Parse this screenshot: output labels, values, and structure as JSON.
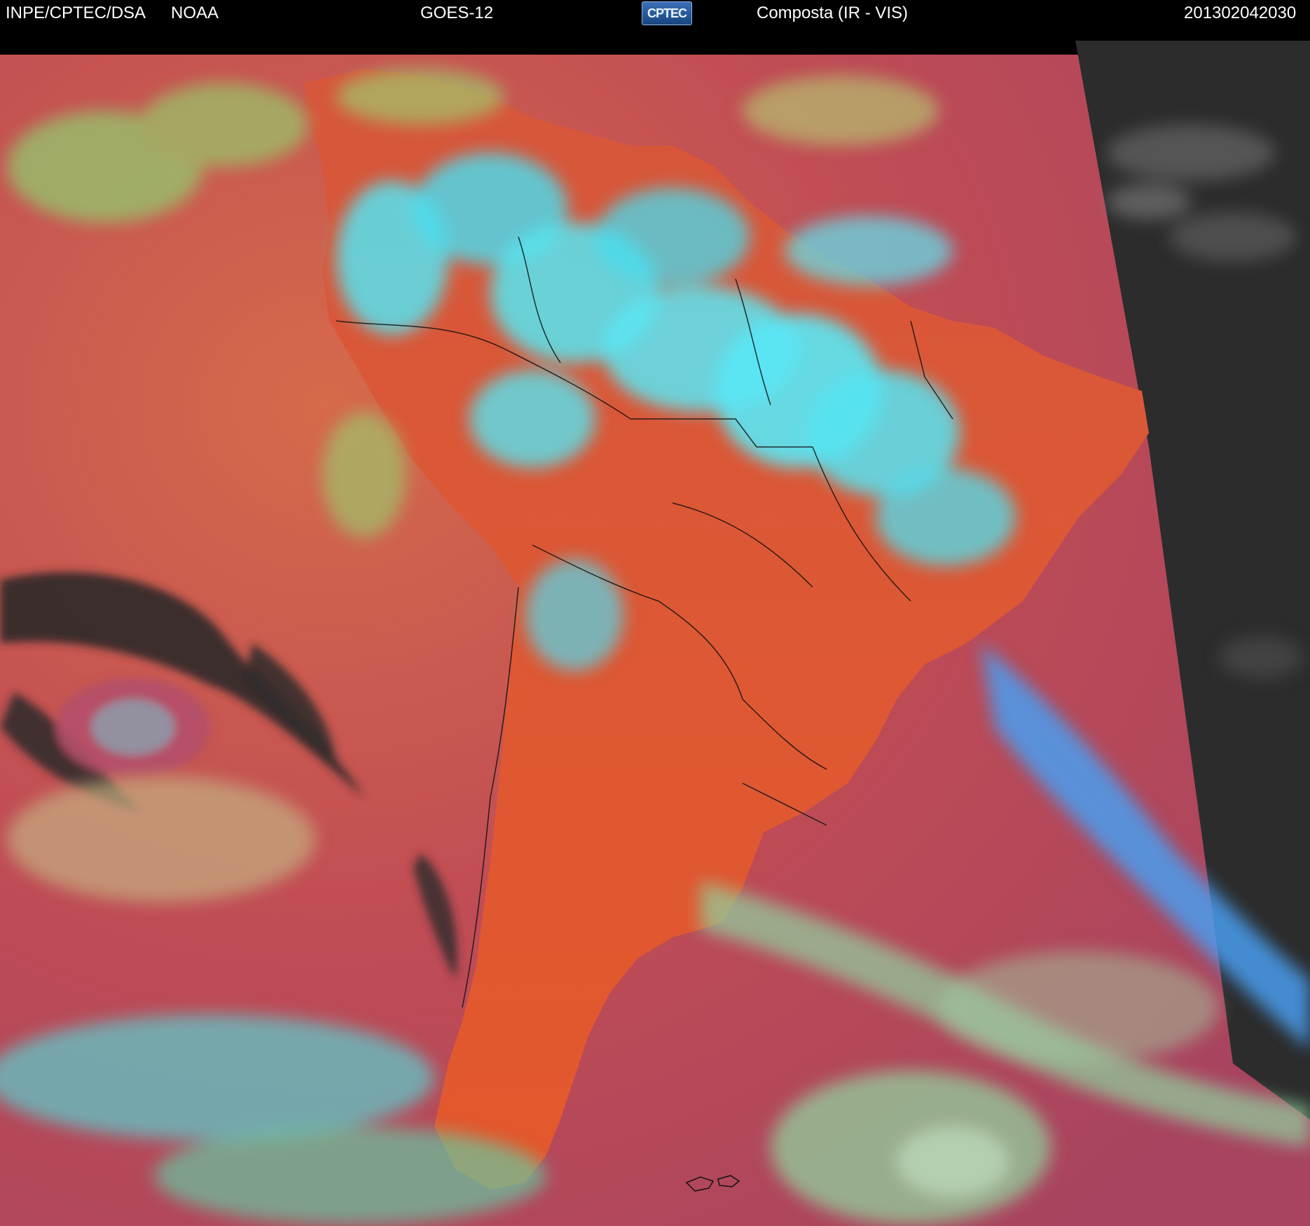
{
  "header": {
    "institution": "INPE/CPTEC/DSA",
    "agency": "NOAA",
    "satellite": "GOES-12",
    "logo_text": "CPTEC",
    "product": "Composta (IR - VIS)",
    "timestamp": "201302042030"
  },
  "map": {
    "region": "South America",
    "colors": {
      "ocean_base": "#b8475a",
      "land_base": "#e0542f",
      "cold_cloud": "#4fe6f4",
      "mid_cloud": "#9fd36b",
      "no_data": "#2a2a2a",
      "border_line": "#111111"
    }
  }
}
